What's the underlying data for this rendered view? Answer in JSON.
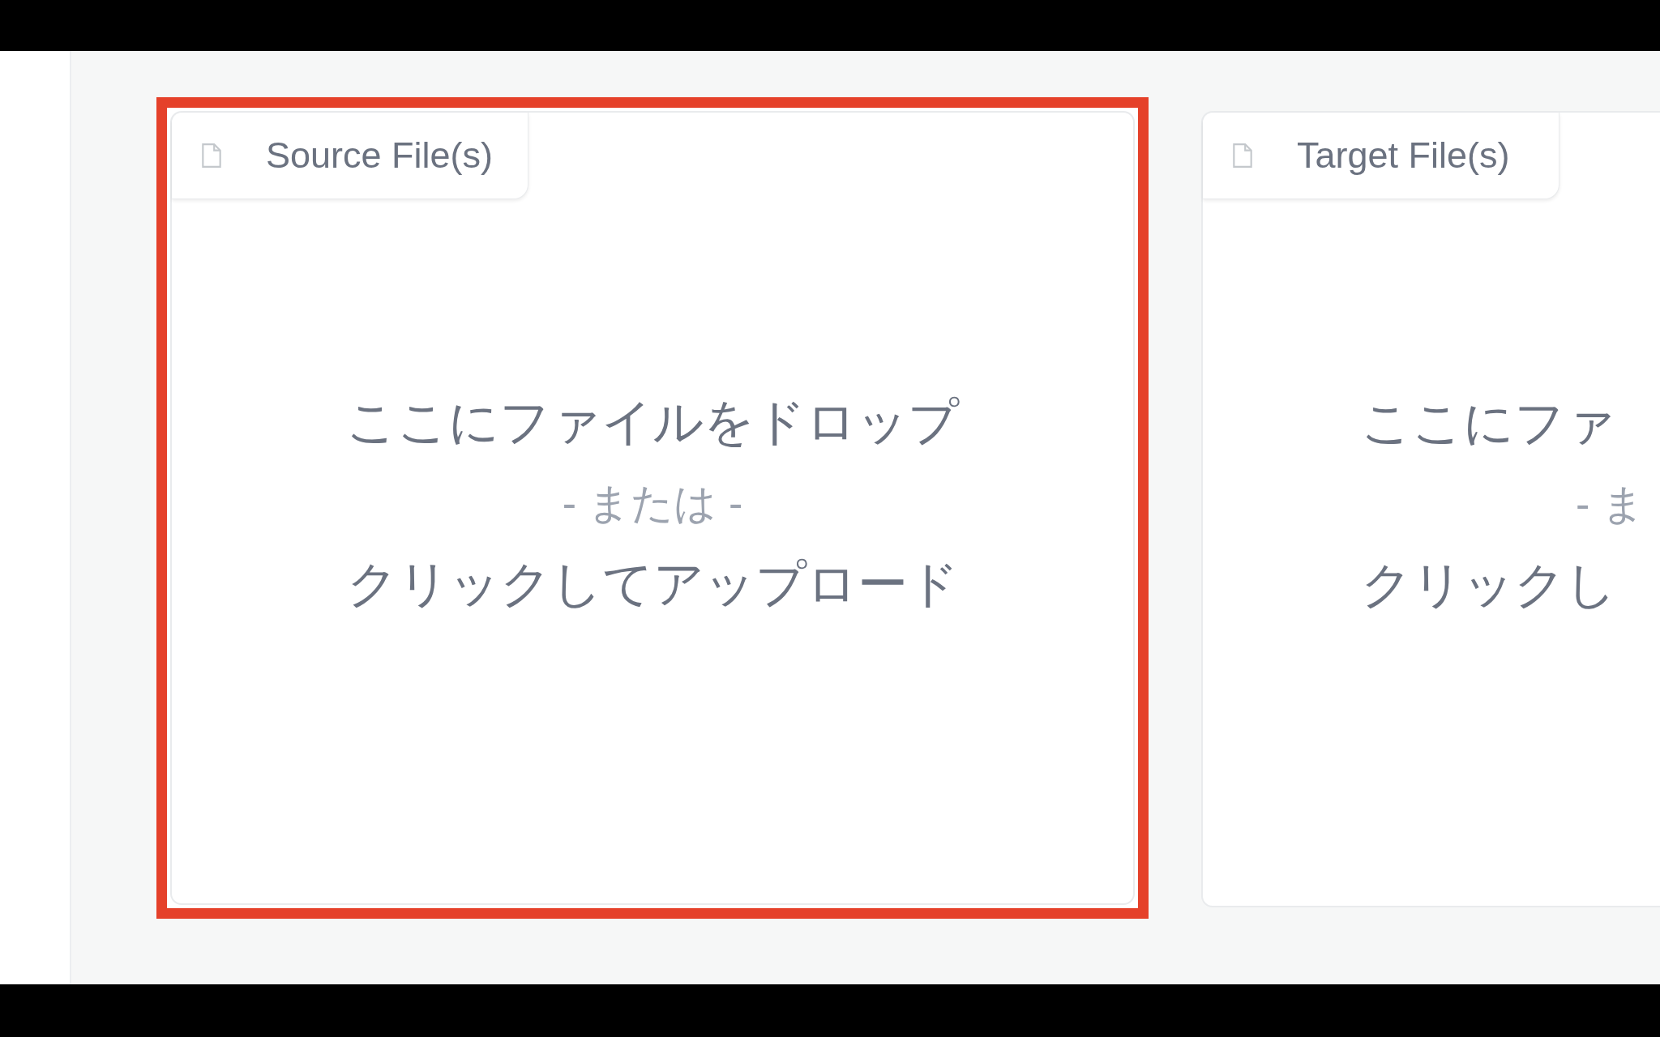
{
  "upload_panels": [
    {
      "label": "Source File(s)",
      "highlighted": true,
      "drop_lines": [
        "ここにファイルをドロップ",
        "- または -",
        "クリックしてアップロード"
      ]
    },
    {
      "label": "Target File(s)",
      "highlighted": false,
      "drop_lines": [
        "ここにファ",
        "- ま",
        "クリックし"
      ]
    }
  ]
}
